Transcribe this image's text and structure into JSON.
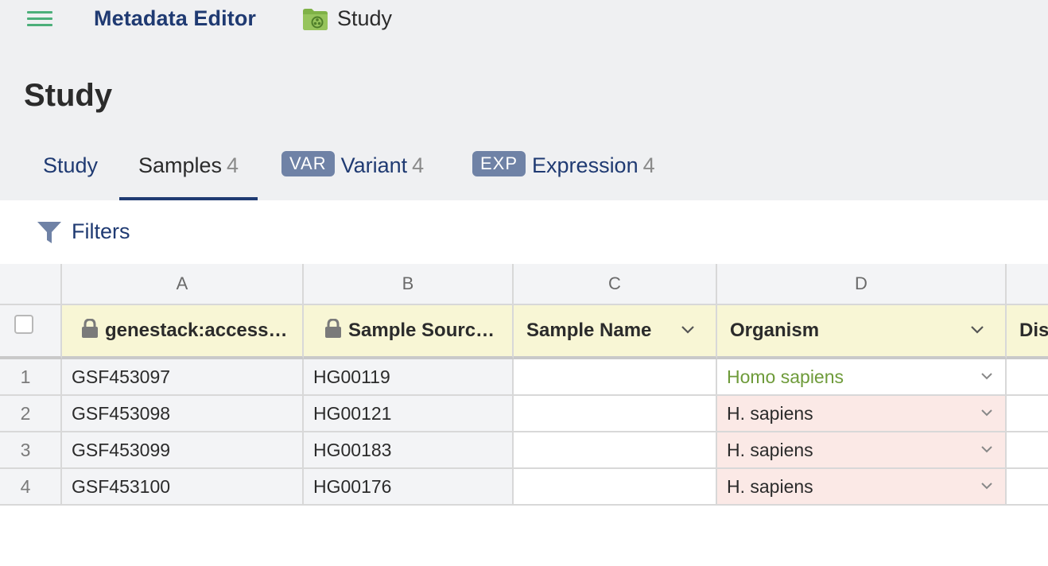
{
  "header": {
    "app_title": "Metadata Editor",
    "breadcrumb": "Study",
    "page_title": "Study"
  },
  "tabs": [
    {
      "label": "Study",
      "count": "",
      "badge": ""
    },
    {
      "label": "Samples",
      "count": "4",
      "badge": ""
    },
    {
      "label": "Variant",
      "count": "4",
      "badge": "VAR"
    },
    {
      "label": "Expression",
      "count": "4",
      "badge": "EXP"
    }
  ],
  "filters": {
    "label": "Filters"
  },
  "grid": {
    "column_letters": [
      "A",
      "B",
      "C",
      "D",
      ""
    ],
    "column_headers": [
      "genestack:access…",
      "Sample Sourc…",
      "Sample Name",
      "Organism",
      "Dis"
    ],
    "rows": [
      {
        "num": "1",
        "accession": "GSF453097",
        "source": "HG00119",
        "name": "",
        "organism": "Homo sapiens",
        "organism_status": "valid"
      },
      {
        "num": "2",
        "accession": "GSF453098",
        "source": "HG00121",
        "name": "",
        "organism": "H. sapiens",
        "organism_status": "invalid"
      },
      {
        "num": "3",
        "accession": "GSF453099",
        "source": "HG00183",
        "name": "",
        "organism": "H. sapiens",
        "organism_status": "invalid"
      },
      {
        "num": "4",
        "accession": "GSF453100",
        "source": "HG00176",
        "name": "",
        "organism": "H. sapiens",
        "organism_status": "invalid"
      }
    ]
  },
  "colors": {
    "brand_navy": "#1f3a72",
    "menu_green": "#4caf7a",
    "header_yellow": "#f8f6d5",
    "valid_green": "#6e9b3a",
    "invalid_pink": "#fbe9e6"
  }
}
